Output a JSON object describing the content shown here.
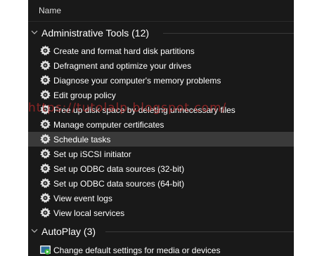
{
  "header": {
    "name_label": "Name"
  },
  "groups": [
    {
      "title": "Administrative Tools (12)",
      "items": [
        {
          "label": "Create and format hard disk partitions",
          "icon": "gear-icon"
        },
        {
          "label": "Defragment and optimize your drives",
          "icon": "gear-icon"
        },
        {
          "label": "Diagnose your computer's memory problems",
          "icon": "gear-icon"
        },
        {
          "label": "Edit group policy",
          "icon": "gear-icon"
        },
        {
          "label": "Free up disk space by deleting unnecessary files",
          "icon": "gear-icon"
        },
        {
          "label": "Manage computer certificates",
          "icon": "gear-icon"
        },
        {
          "label": "Schedule tasks",
          "icon": "gear-icon",
          "selected": true
        },
        {
          "label": "Set up iSCSI initiator",
          "icon": "gear-icon"
        },
        {
          "label": "Set up ODBC data sources (32-bit)",
          "icon": "gear-icon"
        },
        {
          "label": "Set up ODBC data sources (64-bit)",
          "icon": "gear-icon"
        },
        {
          "label": "View event logs",
          "icon": "gear-icon"
        },
        {
          "label": "View local services",
          "icon": "gear-icon"
        }
      ]
    },
    {
      "title": "AutoPlay (3)",
      "items": [
        {
          "label": "Change default settings for media or devices",
          "icon": "autoplay-icon"
        }
      ]
    }
  ],
  "watermark": {
    "text": "https://tutolalp.blogspot.com/"
  },
  "colors": {
    "background": "#191919",
    "selected": "#3a3a3a",
    "text": "#ffffff",
    "autoplay_green": "#3dbb3d"
  }
}
